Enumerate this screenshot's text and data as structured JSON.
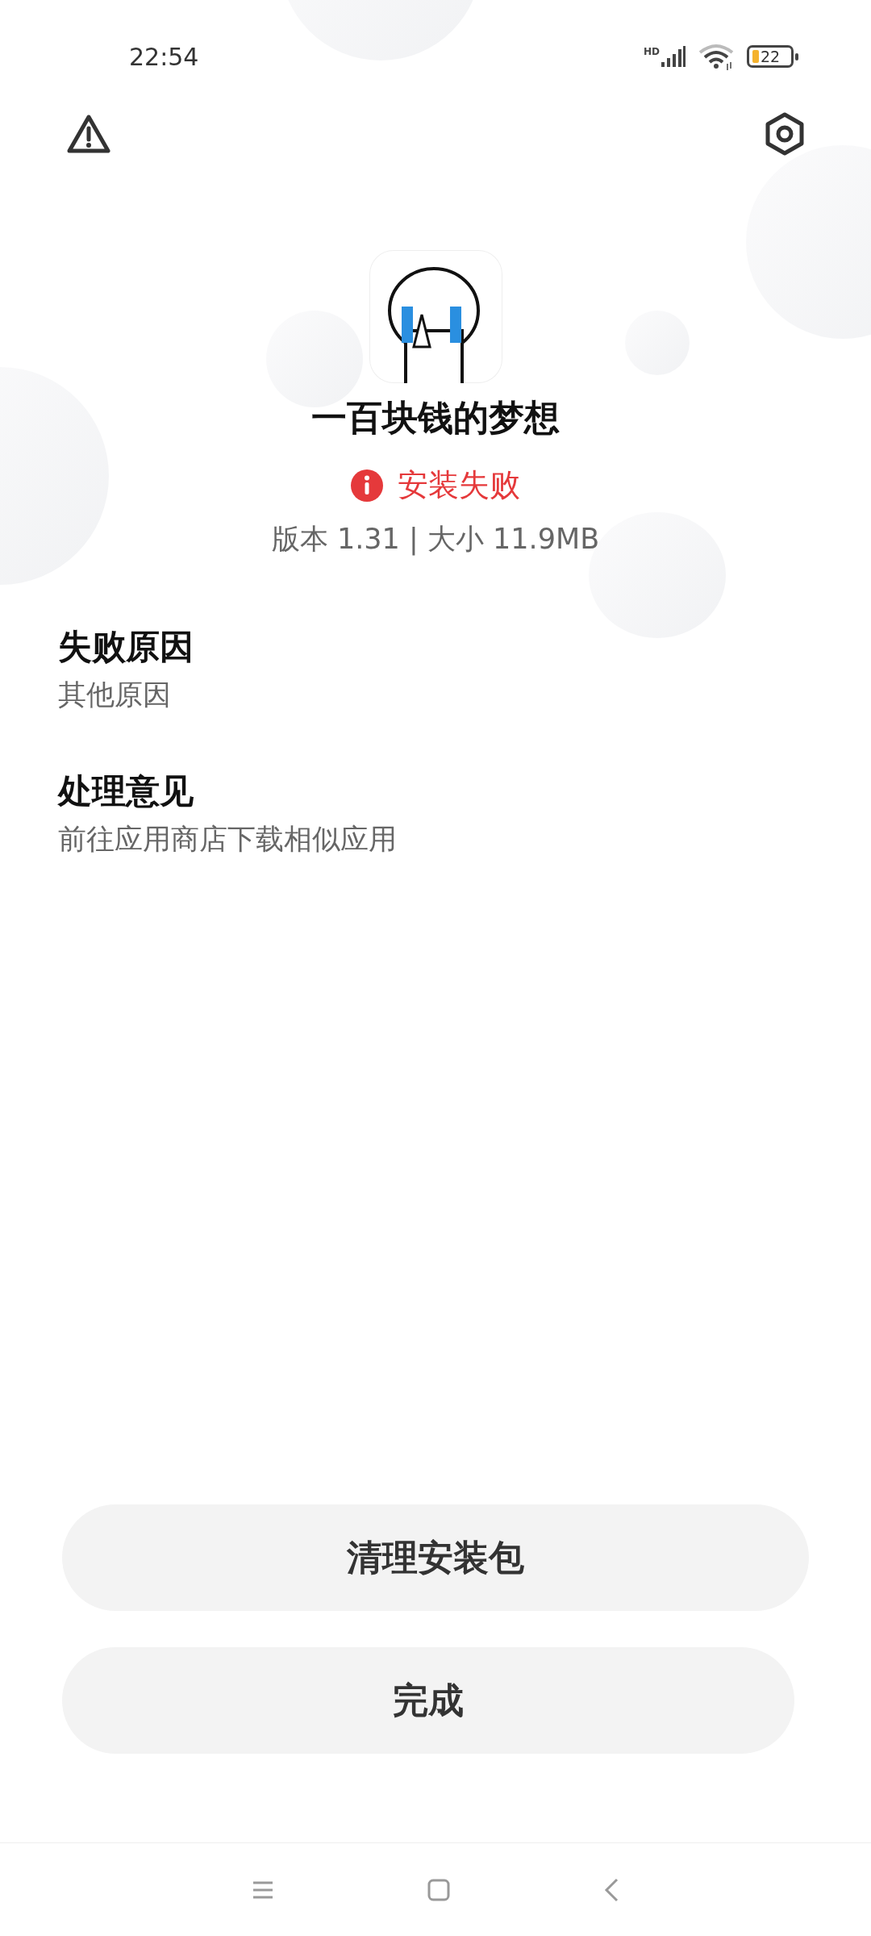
{
  "status_bar": {
    "time": "22:54",
    "network": "HD",
    "battery": "22"
  },
  "app": {
    "name": "一百块钱的梦想",
    "status": {
      "kind": "error",
      "text": "安装失败"
    },
    "info": "版本 1.31 | 大小 11.9MB"
  },
  "sections": [
    {
      "title": "失败原因",
      "body": "其他原因"
    },
    {
      "title": "处理意见",
      "body": "前往应用商店下载相似应用"
    }
  ],
  "buttons": [
    {
      "label": "清理安装包",
      "wide": true
    },
    {
      "label": "完成",
      "wide": false
    }
  ]
}
